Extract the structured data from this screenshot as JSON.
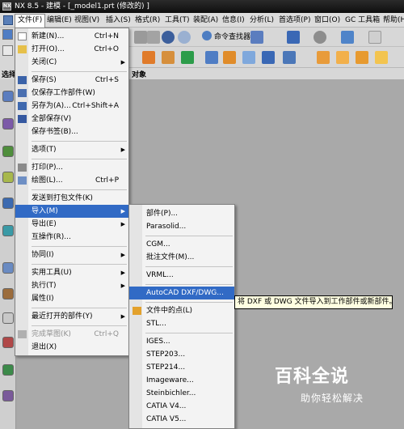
{
  "window": {
    "title": "NX 8.5 - 建模 - [_model1.prt  (修改的) ]",
    "app_icon": "NX"
  },
  "menubar": {
    "items": [
      {
        "label": "文件(F)"
      },
      {
        "label": "编辑(E)"
      },
      {
        "label": "视图(V)"
      },
      {
        "label": "插入(S)"
      },
      {
        "label": "格式(R)"
      },
      {
        "label": "工具(T)"
      },
      {
        "label": "装配(A)"
      },
      {
        "label": "信息(I)"
      },
      {
        "label": "分析(L)"
      },
      {
        "label": "首选项(P)"
      },
      {
        "label": "窗口(O)"
      },
      {
        "label": "GC 工具箱"
      },
      {
        "label": "帮助(H)"
      }
    ]
  },
  "toolbar": {
    "command_finder": "命令查找器"
  },
  "selection_bar": {
    "left_label": "选择",
    "right_label": "对象"
  },
  "file_menu": {
    "items": [
      {
        "label": "新建(N)...",
        "shortcut": "Ctrl+N",
        "icon": "new-file-icon"
      },
      {
        "label": "打开(O)...",
        "shortcut": "Ctrl+O",
        "icon": "open-folder-icon"
      },
      {
        "label": "关闭(C)",
        "submenu": true
      },
      {
        "label": "保存(S)",
        "shortcut": "Ctrl+S",
        "icon": "save-icon"
      },
      {
        "label": "仅保存工作部件(W)",
        "icon": "save-work-part-icon"
      },
      {
        "label": "另存为(A)...",
        "shortcut": "Ctrl+Shift+A",
        "icon": "save-as-icon"
      },
      {
        "label": "全部保存(V)",
        "icon": "save-all-icon"
      },
      {
        "label": "保存书签(B)..."
      },
      {
        "label": "选项(T)",
        "submenu": true
      },
      {
        "label": "打印(P)...",
        "icon": "print-icon"
      },
      {
        "label": "绘图(L)...",
        "shortcut": "Ctrl+P",
        "icon": "plot-icon"
      },
      {
        "label": "发送到打包文件(K)"
      },
      {
        "label": "导入(M)",
        "submenu": true,
        "highlighted": true
      },
      {
        "label": "导出(E)",
        "submenu": true
      },
      {
        "label": "互操作(R)..."
      },
      {
        "label": "协同(I)",
        "submenu": true
      },
      {
        "label": "实用工具(U)",
        "submenu": true
      },
      {
        "label": "执行(T)",
        "submenu": true
      },
      {
        "label": "属性(I)"
      },
      {
        "label": "最近打开的部件(Y)",
        "submenu": true
      },
      {
        "label": "完成草图(K)",
        "shortcut": "Ctrl+Q",
        "disabled": true,
        "icon": "finish-sketch-icon"
      },
      {
        "label": "退出(X)"
      }
    ]
  },
  "import_submenu": {
    "items": [
      {
        "label": "部件(P)..."
      },
      {
        "label": "Parasolid..."
      },
      {
        "label": "CGM..."
      },
      {
        "label": "批注文件(M)..."
      },
      {
        "label": "VRML..."
      },
      {
        "label": "AutoCAD DXF/DWG...",
        "highlighted": true
      },
      {
        "label": "文件中的点(L)",
        "icon": "points-from-file-icon"
      },
      {
        "label": "STL..."
      },
      {
        "label": "IGES..."
      },
      {
        "label": "STEP203..."
      },
      {
        "label": "STEP214..."
      },
      {
        "label": "Imageware..."
      },
      {
        "label": "Steinbichler..."
      },
      {
        "label": "CATIA V4..."
      },
      {
        "label": "CATIA V5..."
      }
    ]
  },
  "tooltip": {
    "text": "将 DXF 或 DWG 文件导入到工作部件或新部件。"
  },
  "watermark": {
    "title": "百科全说",
    "subtitle": "助你轻松解决"
  }
}
